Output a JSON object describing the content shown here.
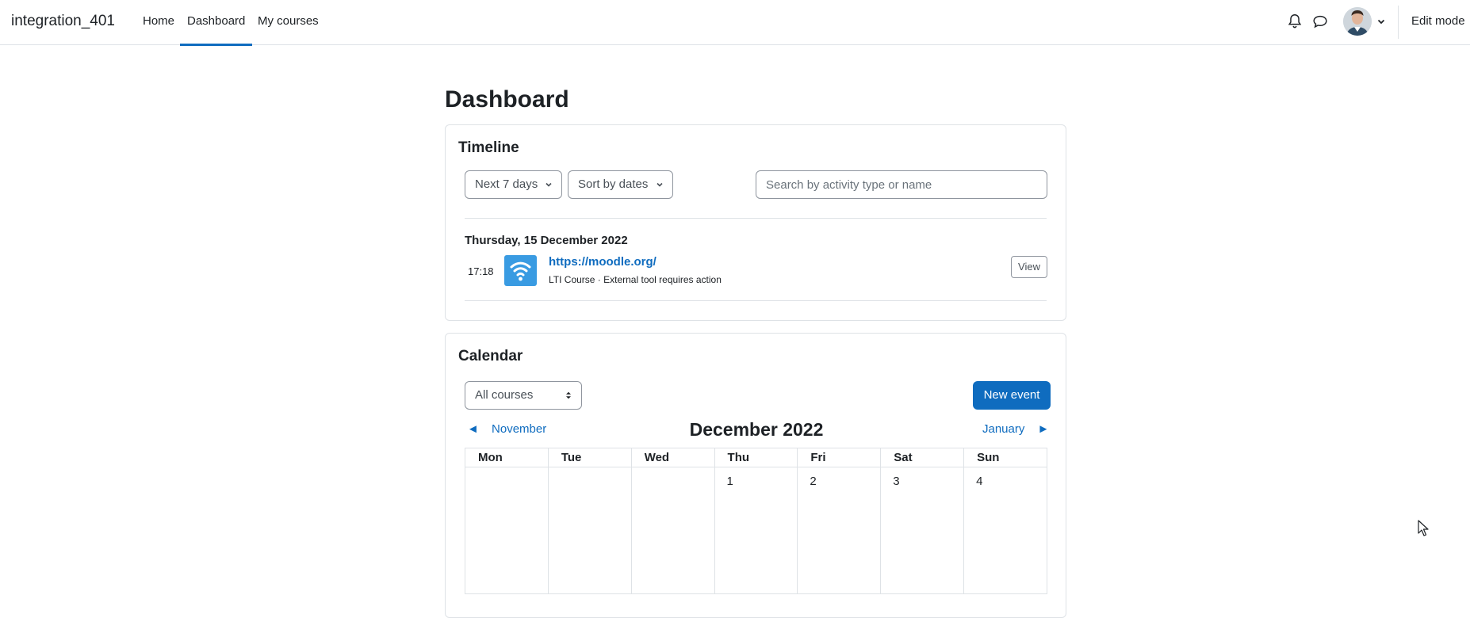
{
  "navbar": {
    "brand": "integration_401",
    "links": [
      {
        "label": "Home",
        "active": false
      },
      {
        "label": "Dashboard",
        "active": true
      },
      {
        "label": "My courses",
        "active": false
      }
    ],
    "icons": [
      "bell-icon",
      "chat-bubble-icon",
      "user-avatar",
      "chevron-down-icon"
    ],
    "edit_mode": "Edit mode"
  },
  "page": {
    "title": "Dashboard"
  },
  "timeline": {
    "title": "Timeline",
    "filter_days": "Next 7 days",
    "sort": "Sort by dates",
    "search_placeholder": "Search by activity type or name",
    "date_heading": "Thursday, 15 December 2022",
    "event": {
      "time": "17:18",
      "icon": "wifi-lti-icon",
      "link": "https://moodle.org/",
      "description": "LTI Course · External tool requires action",
      "view_label": "View"
    }
  },
  "calendar": {
    "title": "Calendar",
    "course_filter": "All courses",
    "new_event": "New event",
    "prev_month": "November",
    "current_month": "December 2022",
    "next_month": "January",
    "weekdays": [
      "Mon",
      "Tue",
      "Wed",
      "Thu",
      "Fri",
      "Sat",
      "Sun"
    ],
    "first_week": [
      "",
      "",
      "",
      "1",
      "2",
      "3",
      "4"
    ]
  },
  "colors": {
    "accent": "#0f6cbf",
    "event_icon_bg": "#399be2",
    "border": "#dee2e6"
  }
}
